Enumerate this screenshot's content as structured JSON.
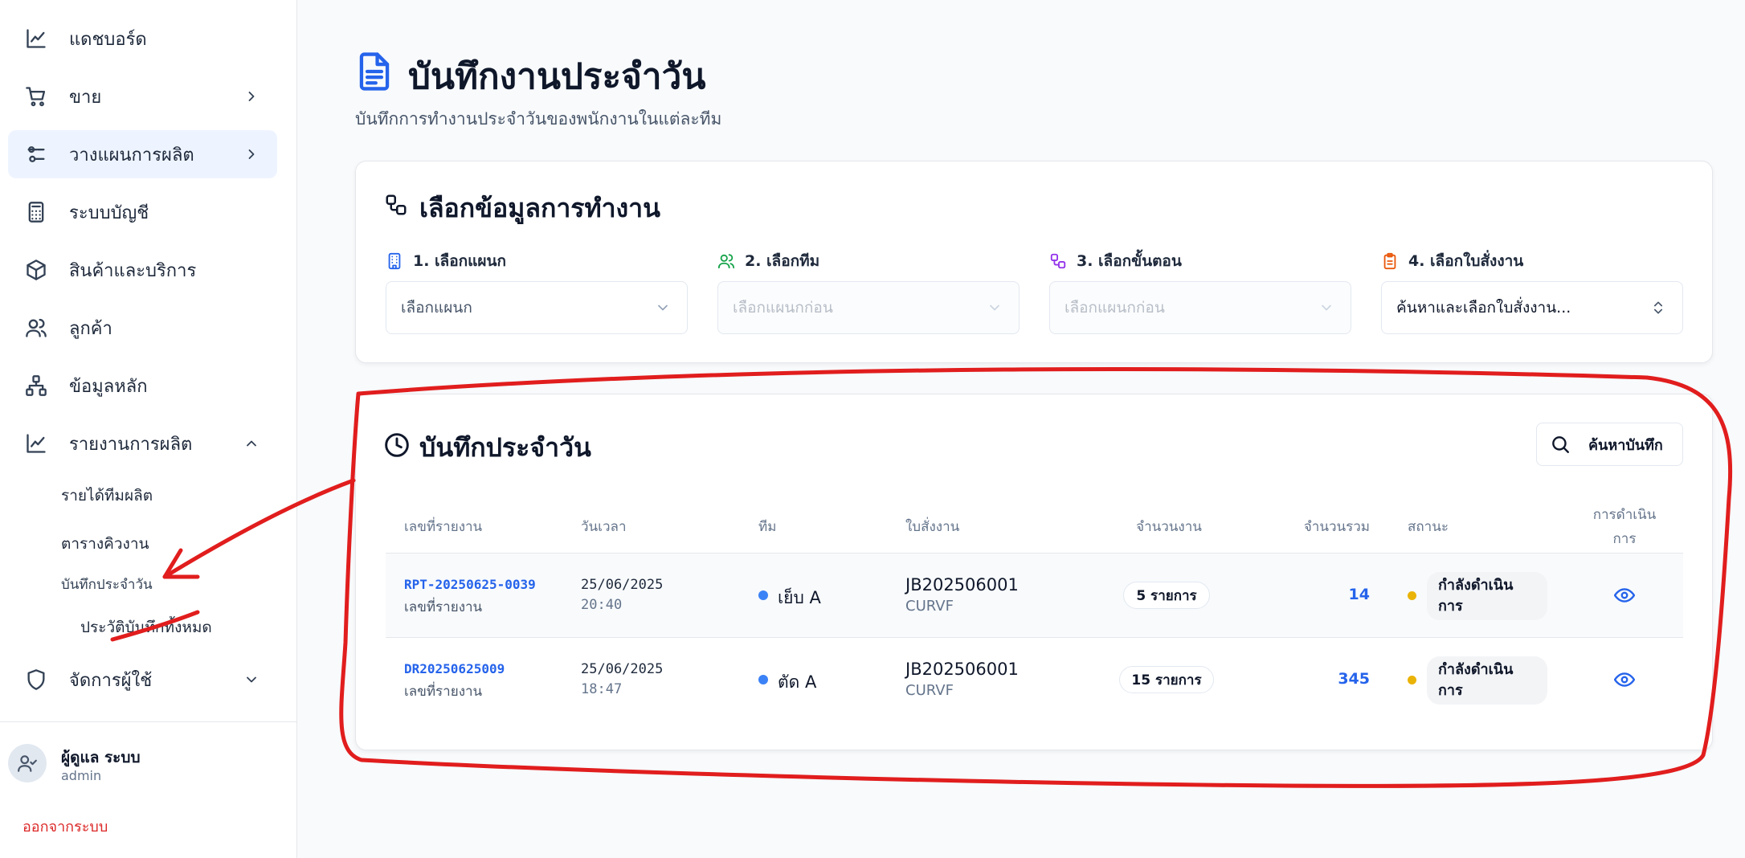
{
  "sidebar": {
    "items": [
      {
        "label": "แดชบอร์ด",
        "icon": "chart-line-icon"
      },
      {
        "label": "ขาย",
        "icon": "shopping-cart-icon"
      },
      {
        "label": "วางแผนการผลิต",
        "icon": "sliders-icon"
      },
      {
        "label": "ระบบบัญชี",
        "icon": "calculator-icon"
      },
      {
        "label": "สินค้าและบริการ",
        "icon": "package-icon"
      },
      {
        "label": "ลูกค้า",
        "icon": "users-icon"
      },
      {
        "label": "ข้อมูลหลัก",
        "icon": "network-icon"
      },
      {
        "label": "รายงานการผลิต",
        "icon": "chart-line-icon"
      },
      {
        "label": "จัดการผู้ใช้",
        "icon": "shield-icon"
      }
    ],
    "sub_items": [
      "รายได้ทีมผลิต",
      "ตารางคิวงาน",
      "บันทึกประจำวัน",
      "ประวัติบันทึกทั้งหมด"
    ],
    "user": {
      "name": "ผู้ดูแล ระบบ",
      "role": "admin"
    },
    "logout_label": "ออกจากระบบ"
  },
  "header": {
    "title": "บันทึกงานประจำวัน",
    "subtitle": "บันทึกการทำงานประจำวันของพนักงานในแต่ละทีม",
    "icon": "file-text-icon"
  },
  "selection": {
    "title": "เลือกข้อมูลการทำงาน",
    "fields": [
      {
        "label": "1. เลือกแผนก",
        "value": "เลือกแผนก",
        "icon": "building-icon",
        "color": "#2563eb"
      },
      {
        "label": "2. เลือกทีม",
        "value": "เลือกแผนกก่อน",
        "icon": "users-icon",
        "color": "#16a34a"
      },
      {
        "label": "3. เลือกขั้นตอน",
        "value": "เลือกแผนกก่อน",
        "icon": "workflow-icon",
        "color": "#9333ea"
      },
      {
        "label": "4. เลือกใบสั่งงาน",
        "value": "ค้นหาและเลือกใบสั่งงาน...",
        "icon": "clipboard-icon",
        "color": "#ea580c"
      }
    ]
  },
  "daily": {
    "title": "บันทึกประจำวัน",
    "search_label": "ค้นหาบันทึก",
    "columns": [
      "เลขที่รายงาน",
      "วันเวลา",
      "ทีม",
      "ใบสั่งงาน",
      "จำนวนงาน",
      "จำนวนรวม",
      "สถานะ",
      "การดำเนินการ"
    ],
    "rows": [
      {
        "report_no": "RPT-20250625-0039",
        "report_sub": "เลขที่รายงาน",
        "date": "25/06/2025",
        "time": "20:40",
        "team": "เย็บ A",
        "job": "JB202506001",
        "job_sub": "CURVF",
        "count": "5 รายการ",
        "total": "14",
        "status": "กำลังดำเนินการ"
      },
      {
        "report_no": "DR20250625009",
        "report_sub": "เลขที่รายงาน",
        "date": "25/06/2025",
        "time": "18:47",
        "team": "ตัด A",
        "job": "JB202506001",
        "job_sub": "CURVF",
        "count": "15 รายการ",
        "total": "345",
        "status": "กำลังดำเนินการ"
      }
    ]
  },
  "colors": {
    "accent": "#2563eb",
    "annotation": "#e11d1d",
    "status_dot": "#eab308",
    "logout": "#dc2626"
  }
}
